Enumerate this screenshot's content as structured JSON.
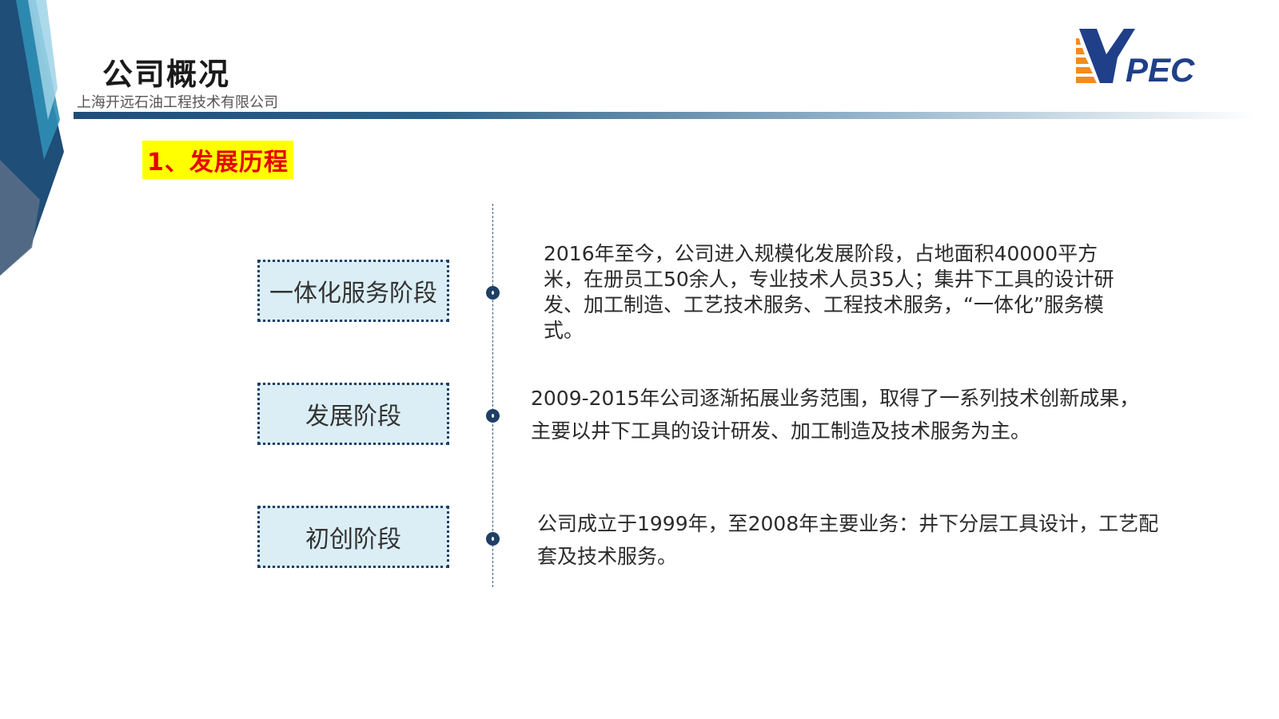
{
  "header": {
    "title": "公司概况",
    "subtitle": "上海开远石油工程技术有限公司",
    "logo_text": "KPEC"
  },
  "section": {
    "heading": "1、发展历程"
  },
  "stages": [
    {
      "label": "一体化服务阶段",
      "description": "2016年至今，公司进入规模化发展阶段，占地面积40000平方米，在册员工50余人，专业技术人员35人；集井下工具的设计研发、加工制造、工艺技术服务、工程技术服务，“一体化”服务模式。"
    },
    {
      "label": "发展阶段",
      "description": "2009-2015年公司逐渐拓展业务范围，取得了一系列技术创新成果，主要以井下工具的设计研发、加工制造及技术服务为主。"
    },
    {
      "label": "初创阶段",
      "description": "公司成立于1999年，至2008年主要业务：井下分层工具设计，工艺配套及技术服务。"
    }
  ],
  "colors": {
    "accent_navy": "#1f3f66",
    "box_fill": "#dbeef5",
    "heading_bg": "#ffff00",
    "heading_text": "#e60000",
    "logo_orange": "#f28c1b",
    "logo_blue": "#1f3f88"
  }
}
